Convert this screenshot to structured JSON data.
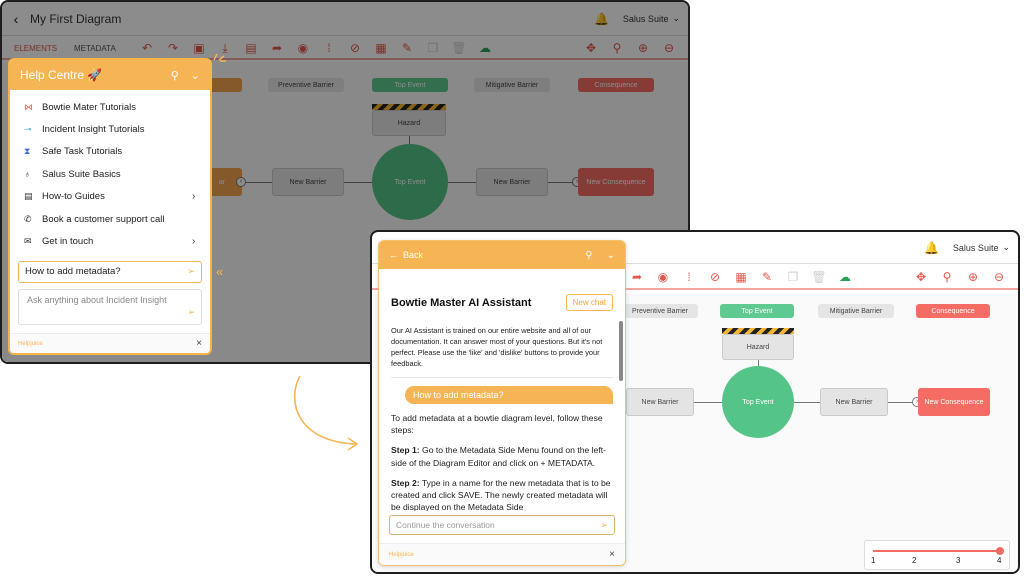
{
  "window1": {
    "back_icon": "chevron-left-icon",
    "title": "My First Diagram",
    "user_menu": "Salus Suite",
    "side_tabs": [
      "ELEMENTS",
      "METADATA"
    ],
    "diagram": {
      "headers": [
        "Preventive Barrier",
        "Top Event",
        "Mitigative Barrier",
        "Consequence"
      ],
      "hazard": "Hazard",
      "top_event": "Top Event",
      "barrier_left": "New Barrier",
      "barrier_right": "New Barrier",
      "consequence": "New Consequence",
      "partial_left": "ar"
    }
  },
  "help_centre": {
    "title": "Help Centre 🚀",
    "items": [
      {
        "icon": "bowtie-icon",
        "label": "Bowtie Mater Tutorials",
        "arrow": ""
      },
      {
        "icon": "insight-icon",
        "label": "Incident Insight Tutorials",
        "arrow": ""
      },
      {
        "icon": "hourglass-icon",
        "label": "Safe Task Tutorials",
        "arrow": ""
      },
      {
        "icon": "lightbulb-icon",
        "label": "Salus Suite Basics",
        "arrow": ""
      },
      {
        "icon": "document-icon",
        "label": "How-to Guides",
        "arrow": "›"
      },
      {
        "icon": "phone-icon",
        "label": "Book a customer support call",
        "arrow": ""
      },
      {
        "icon": "mail-icon",
        "label": "Get in touch",
        "arrow": "›"
      }
    ],
    "query_value": "How to add metadata?",
    "ask_placeholder": "Ask anything about Incident Insight",
    "footer": "Helpjuice",
    "close": "×"
  },
  "window2": {
    "user_menu": "Salus Suite",
    "diagram": {
      "headers": [
        "Preventive Barrier",
        "Top Event",
        "Mitigative Barrier",
        "Consequence"
      ],
      "hazard": "Hazard",
      "top_event": "Top Event",
      "barrier_left": "New Barrier",
      "barrier_right": "New Barrier",
      "consequence": "New Consequence"
    },
    "zoom_ticks": [
      "1",
      "2",
      "3",
      "4"
    ],
    "zoom_level": 4
  },
  "ai_assistant": {
    "back_label": "Back",
    "title": "Bowtie Master AI Assistant",
    "new_chat": "New chat",
    "description": "Our AI Assistant is trained on our entire website and all of our documentation. It can answer most of your questions. But it's not perfect. Please use the 'like' and 'dislike' buttons to provide your feedback.",
    "user_message": "How to add metadata?",
    "answer_intro": "To add metadata at a bowtie diagram level, follow these steps:",
    "step1_label": "Step 1:",
    "step1_text": " Go to the Metadata Side Menu found on the left-side of the Diagram Editor and click on + METADATA.",
    "step2_label": "Step 2:",
    "step2_text": " Type in a name for the new metadata that is to be created and click SAVE. The newly created metadata will be displayed on the Metadata Side",
    "input_placeholder": "Continue the conversation",
    "footer": "Helpjuice",
    "close": "×"
  },
  "colors": {
    "accent": "#f5b554",
    "red": "#f46c63",
    "green": "#55c488"
  }
}
